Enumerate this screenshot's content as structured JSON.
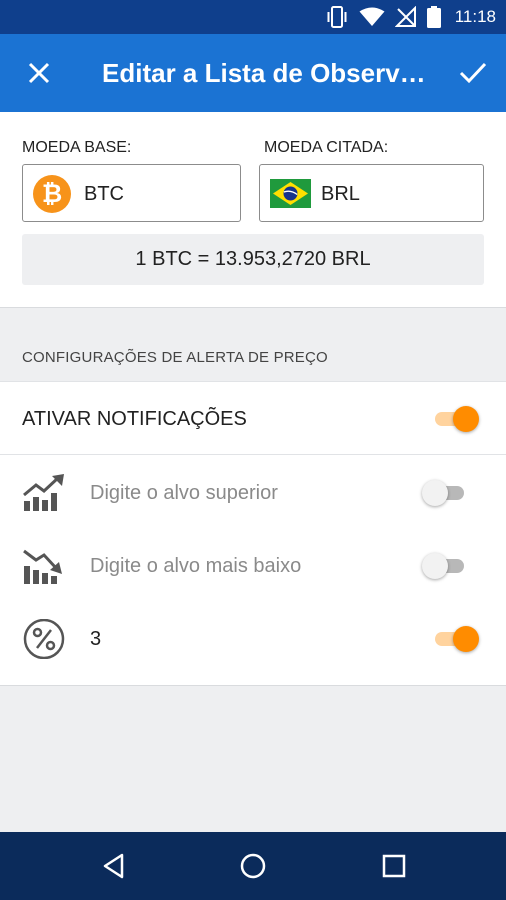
{
  "status_bar": {
    "time": "11:18",
    "icons": [
      "vibrate-icon",
      "wifi-icon",
      "no-signal-icon",
      "battery-icon"
    ]
  },
  "app_bar": {
    "title": "Editar a Lista de Observação",
    "close_icon": "close-icon",
    "confirm_icon": "check-icon",
    "color": "#1b73d3"
  },
  "pair": {
    "base_label": "MOEDA BASE:",
    "base_code": "BTC",
    "base_icon_glyph": "₿",
    "quote_label": "MOEDA CITADA:",
    "quote_code": "BRL",
    "quote_icon": "brazil-flag-icon",
    "rate": "1 BTC = 13.953,2720 BRL"
  },
  "alerts": {
    "header": "CONFIGURAÇÕES DE ALERTA DE PREÇO",
    "notifications_label": "ATIVAR NOTIFICAÇÕES",
    "notifications_on": true,
    "rows": [
      {
        "icon": "chart-up-icon",
        "placeholder": "Digite o alvo superior",
        "enabled": false
      },
      {
        "icon": "chart-down-icon",
        "placeholder": "Digite o alvo mais baixo",
        "enabled": false
      },
      {
        "icon": "percent-icon",
        "value": "3",
        "enabled": true
      }
    ],
    "accent": "#ff8c00"
  },
  "nav_bar": {
    "buttons": [
      "back-icon",
      "home-icon",
      "recents-icon"
    ]
  }
}
